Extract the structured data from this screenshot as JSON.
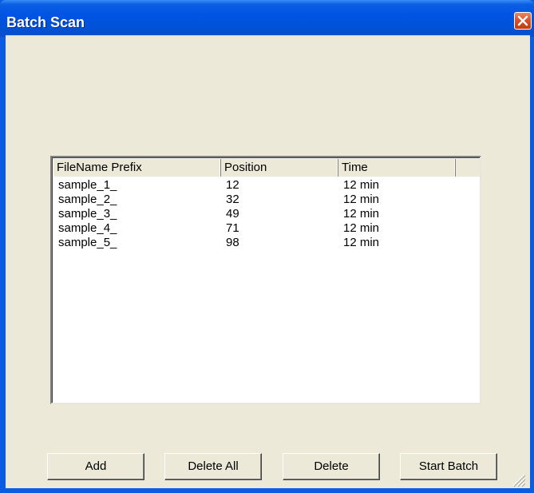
{
  "window": {
    "title": "Batch Scan",
    "title_color": "#ffffff",
    "titlebar_color": "#0054e3",
    "client_color": "#ece9d8"
  },
  "icons": {
    "close": "close-icon",
    "resize": "resize-grip-icon"
  },
  "list": {
    "columns": [
      "FileName Prefix",
      "Position",
      "Time"
    ],
    "rows": [
      {
        "prefix": "sample_1_",
        "position": "12",
        "time": "12 min"
      },
      {
        "prefix": "sample_2_",
        "position": "32",
        "time": "12 min"
      },
      {
        "prefix": "sample_3_",
        "position": "49",
        "time": "12 min"
      },
      {
        "prefix": "sample_4_",
        "position": "71",
        "time": "12 min"
      },
      {
        "prefix": "sample_5_",
        "position": "98",
        "time": "12 min"
      }
    ]
  },
  "buttons": {
    "add": "Add",
    "delete_all": "Delete All",
    "delete": "Delete",
    "start_batch": "Start Batch"
  }
}
